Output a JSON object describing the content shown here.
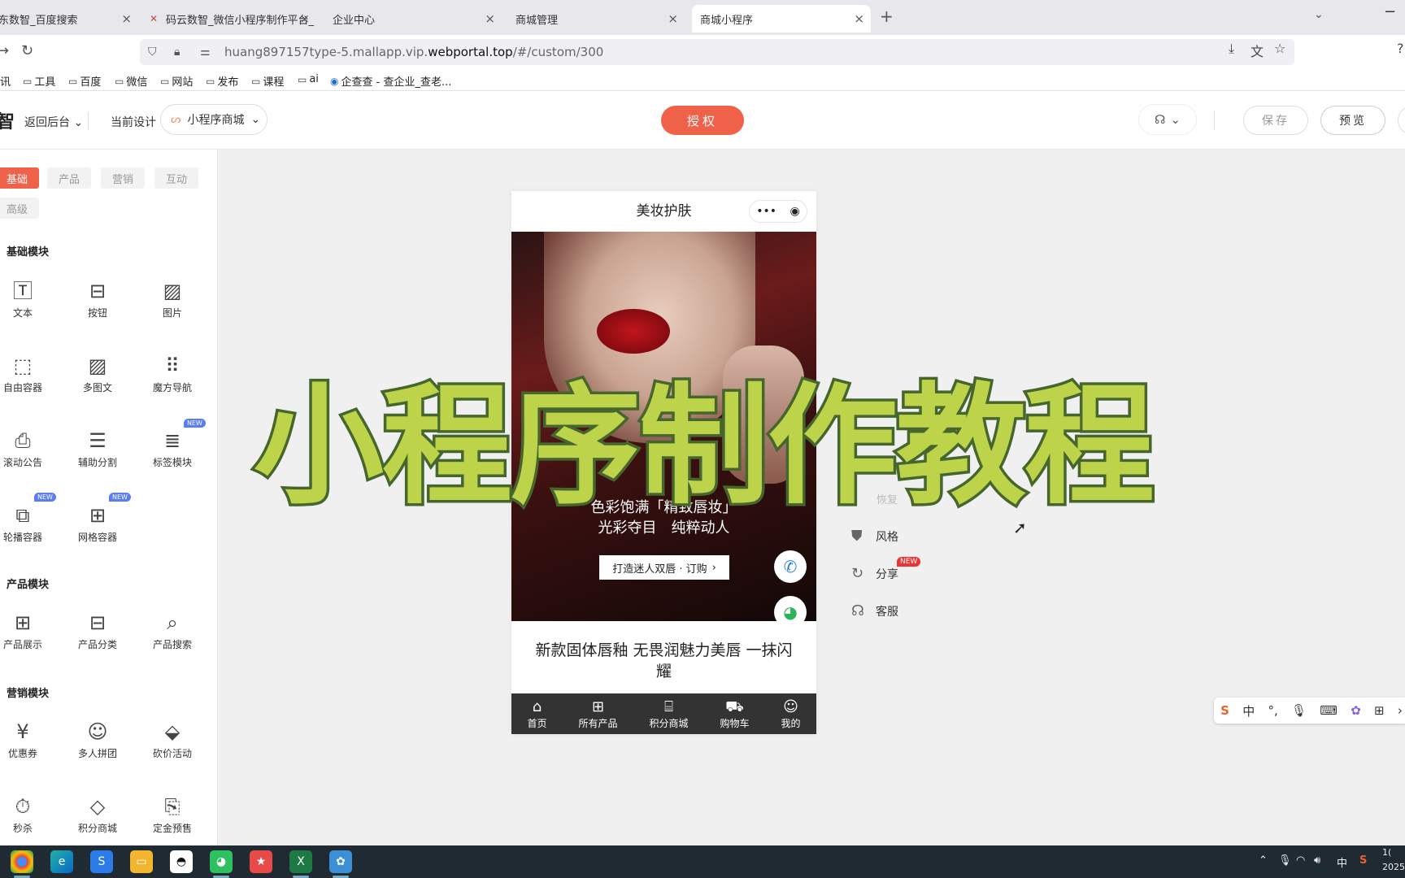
{
  "browser": {
    "tabs": [
      {
        "label": "东数智_百度搜索",
        "active": false
      },
      {
        "label": "码云数智_微信小程序制作平台_",
        "active": false
      },
      {
        "label": "企业中心",
        "active": false
      },
      {
        "label": "商城管理",
        "active": false
      },
      {
        "label": "商城小程序",
        "active": true
      }
    ],
    "close_glyph": "×",
    "new_tab_glyph": "+",
    "url_prefix": "huang897157type-5.mallapp.vip.",
    "url_domain": "webportal.top",
    "url_suffix": "/#/custom/300",
    "bookmarks": [
      "讯",
      "工具",
      "百度",
      "微信",
      "网站",
      "发布",
      "课程",
      "ai",
      "企查查 - 查企业_查老..."
    ]
  },
  "app_header": {
    "logo": "智",
    "back_label": "返回后台",
    "current_design_label": "当前设计",
    "app_selector": "小程序商城",
    "authorize_button": "授权",
    "save_button": "保存",
    "preview_button": "预览"
  },
  "sidebar": {
    "categories": [
      "基础",
      "产品",
      "营销",
      "互动",
      "高级"
    ],
    "active_category": "基础",
    "sections": [
      {
        "title": "基础模块",
        "items": [
          "文本",
          "按钮",
          "图片",
          "自由容器",
          "多图文",
          "魔方导航",
          "滚动公告",
          "辅助分割",
          "标签模块",
          "轮播容器",
          "网格容器"
        ]
      },
      {
        "title": "产品模块",
        "items": [
          "产品展示",
          "产品分类",
          "产品搜索"
        ]
      },
      {
        "title": "营销模块",
        "items": [
          "优惠券",
          "多人拼团",
          "砍价活动",
          "秒杀",
          "积分商城",
          "定金预售"
        ]
      }
    ],
    "new_badge": "NEW"
  },
  "phone": {
    "title": "美妆护肤",
    "banner_line1": "色彩饱满「精致唇妆」",
    "banner_line2": "光彩夺目　纯粹动人",
    "banner_button": "打造迷人双唇 · 订购",
    "caption": "新款固体唇釉 无畏润魅力美唇 一抹闪耀",
    "tabbar": [
      "首页",
      "所有产品",
      "积分商城",
      "购物车",
      "我的"
    ]
  },
  "right_panel": {
    "restore": "恢复",
    "items": [
      "风格",
      "分享",
      "客服"
    ],
    "share_badge": "NEW"
  },
  "overlay_title": "小程序制作教程",
  "ime_bar": {
    "mode": "中"
  },
  "taskbar": {
    "tray_lang": "中",
    "clock_time": "1(",
    "clock_date": "2025"
  }
}
